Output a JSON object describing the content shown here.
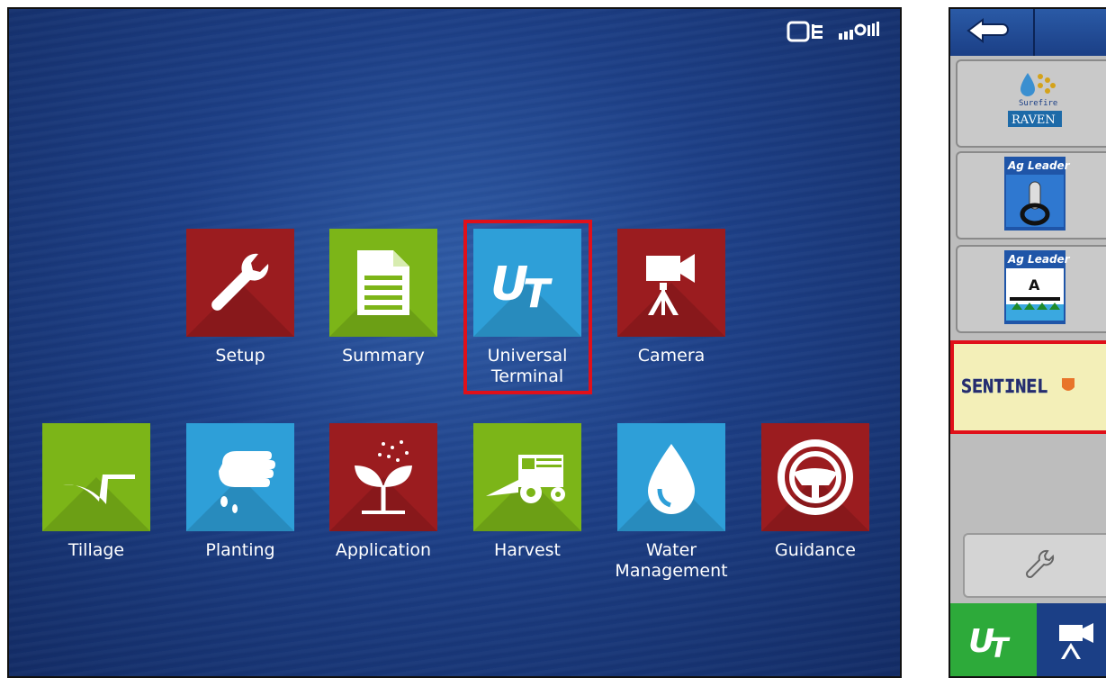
{
  "home": {
    "tiles": [
      {
        "label": "Setup",
        "icon": "wrench-icon",
        "color": "#9b1c1f"
      },
      {
        "label": "Summary",
        "icon": "document-icon",
        "color": "#7cb518"
      },
      {
        "label": "Universal\nTerminal",
        "icon": "ut-logo-icon",
        "color": "#2e9fd8",
        "highlighted": true
      },
      {
        "label": "Camera",
        "icon": "camera-icon",
        "color": "#9b1c1f"
      },
      {
        "label": "Tillage",
        "icon": "plow-icon",
        "color": "#7cb518"
      },
      {
        "label": "Planting",
        "icon": "hand-seed-icon",
        "color": "#2e9fd8"
      },
      {
        "label": "Application",
        "icon": "plant-spray-icon",
        "color": "#9b1c1f"
      },
      {
        "label": "Harvest",
        "icon": "combine-icon",
        "color": "#7cb518"
      },
      {
        "label": "Water\nManagement",
        "icon": "water-drop-icon",
        "color": "#2e9fd8"
      },
      {
        "label": "Guidance",
        "icon": "steering-wheel-icon",
        "color": "#9b1c1f"
      }
    ],
    "status_icons": [
      "display-status-icon",
      "signal-strength-icon"
    ]
  },
  "ut_panel": {
    "back_icon": "back-arrow-icon",
    "items": [
      {
        "brand": "Surefire",
        "brand_sub": "RAVEN",
        "icon": "surefire-raven-logo-icon"
      },
      {
        "brand": "Ag Leader",
        "icon": "ag-leader-switch-icon"
      },
      {
        "brand": "Ag Leader",
        "icon": "ag-leader-boom-icon",
        "badge": "A"
      },
      {
        "brand": "SENTINEL",
        "icon": "sentinel-logo-icon",
        "highlighted": true
      }
    ],
    "tool_icon": "wrench-icon",
    "bottom_tabs": [
      "ut-logo-icon",
      "camera-icon"
    ]
  },
  "colors": {
    "highlight": "#e0101a",
    "background_blue": "#1d3f86"
  }
}
